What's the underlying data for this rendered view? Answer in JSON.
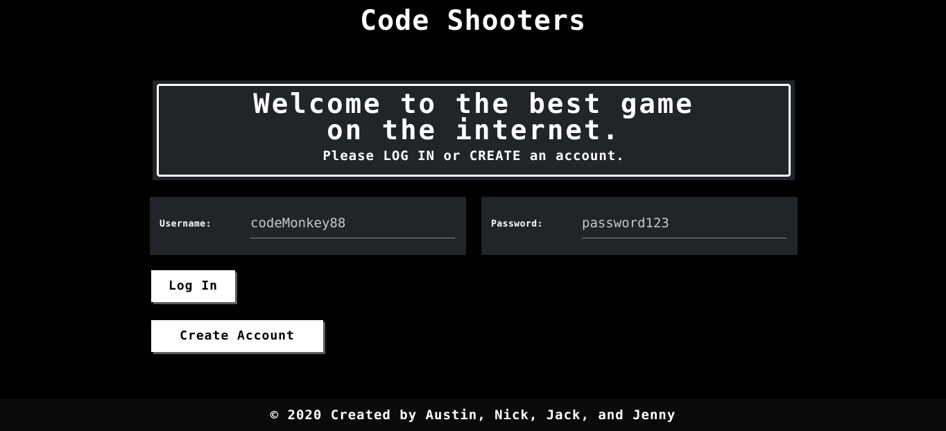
{
  "header": {
    "title": "Code Shooters"
  },
  "welcome": {
    "headline_line1": "Welcome to the best game",
    "headline_line2": "on the internet.",
    "subtext": "Please LOG IN or CREATE an account."
  },
  "form": {
    "username": {
      "label": "Username:",
      "value": "codeMonkey88"
    },
    "password": {
      "label": "Password:",
      "value": "password123"
    }
  },
  "buttons": {
    "login_label": "Log In",
    "create_label": "Create Account"
  },
  "footer": {
    "text": "© 2020 Created by Austin, Nick, Jack, and Jenny"
  },
  "colors": {
    "background": "#000000",
    "panel": "#212429",
    "text": "#ffffff",
    "button_bg": "#ffffff",
    "button_shadow": "#5a5f66"
  }
}
